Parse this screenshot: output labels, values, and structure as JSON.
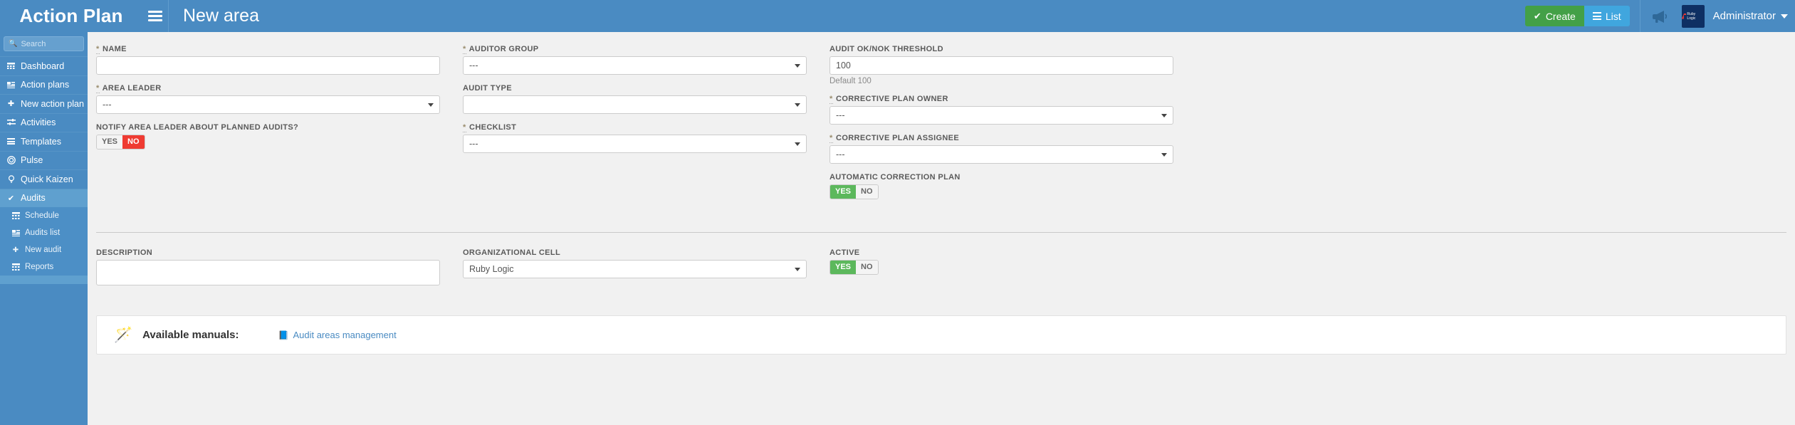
{
  "app": {
    "brand": "Action Plan",
    "page_title": "New area",
    "accent_blue": "#4a8bc2",
    "accent_green": "#43a047",
    "accent_red": "#ef3b32"
  },
  "topbar": {
    "menu_icon": "hamburger-icon",
    "create_label": "Create",
    "list_label": "List",
    "announcement_icon": "megaphone-icon",
    "avatar_text": "Ruby Logic",
    "username": "Administrator"
  },
  "sidebar": {
    "search_placeholder": "Search",
    "search_value": "",
    "items": [
      {
        "label": "Dashboard",
        "icon": "calendar-icon",
        "active": false
      },
      {
        "label": "Action plans",
        "icon": "list-card-icon",
        "active": false
      },
      {
        "label": "New action plan",
        "icon": "plus-icon",
        "active": false
      },
      {
        "label": "Activities",
        "icon": "sliders-icon",
        "active": false
      },
      {
        "label": "Templates",
        "icon": "bars-icon",
        "active": false
      },
      {
        "label": "Pulse",
        "icon": "target-icon",
        "active": false
      },
      {
        "label": "Quick Kaizen",
        "icon": "lightbulb-icon",
        "active": false
      },
      {
        "label": "Audits",
        "icon": "check-icon",
        "active": true
      }
    ],
    "subitems": [
      {
        "label": "Schedule",
        "icon": "calendar-icon"
      },
      {
        "label": "Audits list",
        "icon": "list-card-icon"
      },
      {
        "label": "New audit",
        "icon": "plus-icon"
      },
      {
        "label": "Reports",
        "icon": "grid-icon"
      }
    ]
  },
  "form": {
    "col1": {
      "name": {
        "label": "NAME",
        "required": true,
        "value": ""
      },
      "area_leader": {
        "label": "AREA LEADER",
        "required": true,
        "value": "---"
      },
      "notify": {
        "label": "NOTIFY AREA LEADER ABOUT PLANNED AUDITS?",
        "yes_label": "YES",
        "no_label": "NO",
        "selected": "NO"
      },
      "description": {
        "label": "DESCRIPTION",
        "value": ""
      }
    },
    "col2": {
      "auditor_group": {
        "label": "AUDITOR GROUP",
        "required": true,
        "value": "---"
      },
      "audit_type": {
        "label": "AUDIT TYPE",
        "required": false,
        "value": ""
      },
      "checklist": {
        "label": "CHECKLIST",
        "required": true,
        "value": "---"
      },
      "organizational_cell": {
        "label": "ORGANIZATIONAL CELL",
        "value": "Ruby Logic"
      }
    },
    "col3": {
      "threshold": {
        "label": "AUDIT OK/NOK THRESHOLD",
        "value": "100",
        "help": "Default 100"
      },
      "corrective_plan_owner": {
        "label": "CORRECTIVE PLAN OWNER",
        "required": true,
        "value": "---"
      },
      "corrective_plan_assignee": {
        "label": "CORRECTIVE PLAN ASSIGNEE",
        "required": true,
        "value": "---"
      },
      "automatic_correction_plan": {
        "label": "AUTOMATIC CORRECTION PLAN",
        "yes_label": "YES",
        "no_label": "NO",
        "selected": "YES"
      },
      "active": {
        "label": "ACTIVE",
        "yes_label": "YES",
        "no_label": "NO",
        "selected": "YES"
      }
    }
  },
  "manuals": {
    "icon": "magic-wand-icon",
    "label": "Available manuals:",
    "link_icon": "book-icon",
    "link_label": "Audit areas management"
  }
}
